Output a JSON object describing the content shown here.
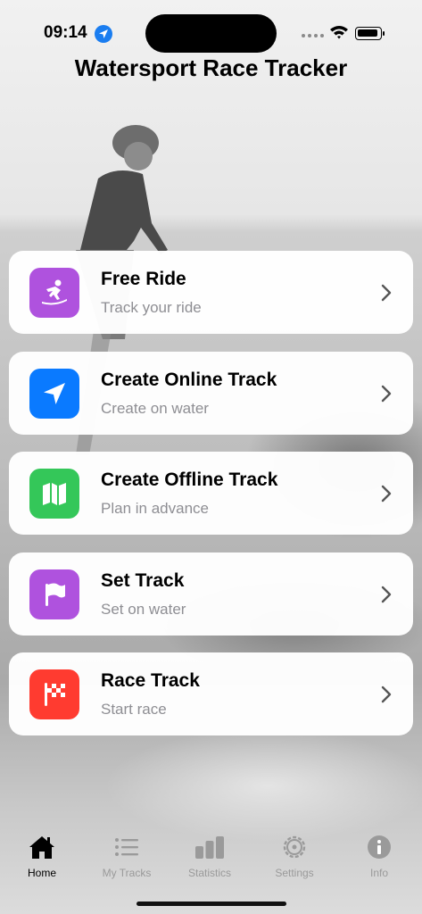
{
  "status_bar": {
    "time": "09:14"
  },
  "header": {
    "title": "Watersport Race Tracker"
  },
  "menu": {
    "items": [
      {
        "title": "Free Ride",
        "subtitle": "Track your ride",
        "icon": "surfer-icon",
        "color": "#af52de"
      },
      {
        "title": "Create Online Track",
        "subtitle": "Create on water",
        "icon": "location-arrow-icon",
        "color": "#0a7aff"
      },
      {
        "title": "Create Offline Track",
        "subtitle": "Plan in advance",
        "icon": "map-icon",
        "color": "#34c759"
      },
      {
        "title": "Set Track",
        "subtitle": "Set on water",
        "icon": "flag-icon",
        "color": "#af52de"
      },
      {
        "title": "Race Track",
        "subtitle": "Start race",
        "icon": "checkered-flag-icon",
        "color": "#ff3b30"
      }
    ]
  },
  "tabbar": {
    "tabs": [
      {
        "label": "Home",
        "icon": "house-icon",
        "active": true
      },
      {
        "label": "My Tracks",
        "icon": "list-icon",
        "active": false
      },
      {
        "label": "Statistics",
        "icon": "bar-chart-icon",
        "active": false
      },
      {
        "label": "Settings",
        "icon": "gear-icon",
        "active": false
      },
      {
        "label": "Info",
        "icon": "info-icon",
        "active": false
      }
    ]
  }
}
